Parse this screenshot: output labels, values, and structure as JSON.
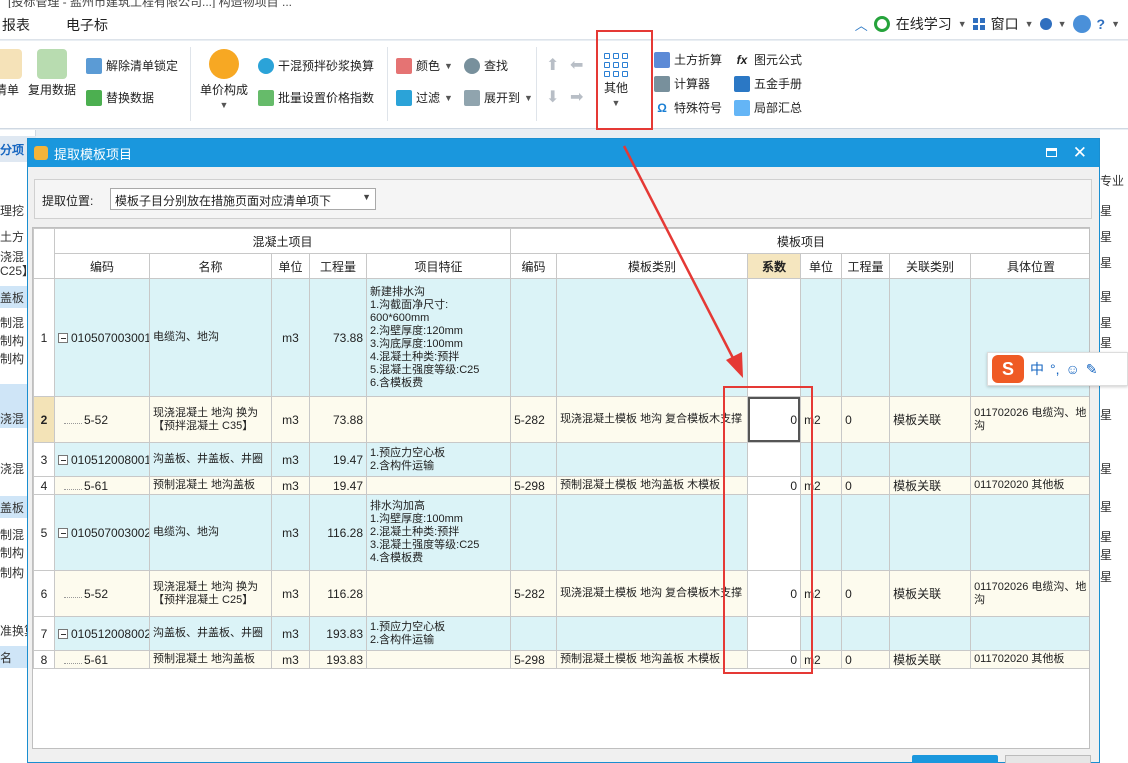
{
  "window": {
    "title_partial": "[投标管理 - 盐州市建筑工程有限公司...] 构造物项目 ...",
    "menu": [
      "报表",
      "电子标"
    ],
    "right": {
      "online": "在线学习",
      "window": "窗口",
      "help": "?"
    }
  },
  "ribbon": {
    "g1": {
      "qingdan": "清单",
      "reuse": "复用数据",
      "unlock": "解除清单锁定",
      "replace": "替换数据"
    },
    "g2": {
      "unit_compose": "单价构成",
      "mortar": "干混预拌砂浆换算",
      "batch_price": "批量设置价格指数"
    },
    "g3": {
      "color": "颜色",
      "find": "查找",
      "filter": "过滤",
      "expand": "展开到"
    },
    "g4": {
      "other": "其他"
    },
    "g5": {
      "earth": "土方折算",
      "calc": "计算器",
      "special": "特殊符号",
      "formula": "图元公式",
      "hardware": "五金手册",
      "local_sum": "局部汇总"
    }
  },
  "background": {
    "left_tab": "分项",
    "left_rows": [
      "理挖",
      "土方",
      "浇混",
      "C25】",
      "盖板",
      "制混",
      "制构",
      "制构",
      "浇混",
      "浇混",
      "盖板",
      "制混",
      "制构",
      "制构",
      "准换算",
      "名"
    ],
    "right_header": "专业",
    "right_rows": [
      "星",
      "星",
      "星",
      "星",
      "星",
      "星",
      "星",
      "星",
      "星",
      "星",
      "星",
      "星"
    ]
  },
  "dialog": {
    "title": "提取模板项目",
    "position_label": "提取位置:",
    "position_value": "模板子目分别放在措施页面对应清单项下",
    "group_concrete": "混凝土项目",
    "group_formwork": "模板项目",
    "columns": {
      "code": "编码",
      "name": "名称",
      "unit": "单位",
      "qty": "工程量",
      "feature": "项目特征",
      "f_code": "编码",
      "f_type": "模板类别",
      "coef": "系数",
      "f_unit": "单位",
      "f_qty": "工程量",
      "relation": "关联类别",
      "location": "具体位置"
    },
    "rows": [
      {
        "idx": "1",
        "code": "010507003001",
        "name": "电缆沟、地沟",
        "unit": "m3",
        "qty": "73.88",
        "feature": [
          "新建排水沟",
          "1.沟截面净尺寸:",
          "600*600mm",
          "2.沟壁厚度:120mm",
          "3.沟底厚度:100mm",
          "4.混凝土种类:预拌",
          "5.混凝土强度等级:C25",
          "6.含模板费"
        ],
        "f_code": "",
        "f_type": "",
        "coef": "",
        "f_unit": "",
        "f_qty": "",
        "relation": "",
        "location": ""
      },
      {
        "idx": "2",
        "code": "5-52",
        "name": "现浇混凝土 地沟  换为【预拌混凝土 C35】",
        "unit": "m3",
        "qty": "73.88",
        "feature": [],
        "f_code": "5-282",
        "f_type": "现浇混凝土模板 地沟 复合模板木支撑",
        "coef": "0",
        "f_unit": "m2",
        "f_qty": "0",
        "relation": "模板关联",
        "location": "011702026  电缆沟、地沟"
      },
      {
        "idx": "3",
        "code": "010512008001",
        "name": "沟盖板、井盖板、井圈",
        "unit": "m3",
        "qty": "19.47",
        "feature": [
          "1.预应力空心板",
          "2.含构件运输"
        ],
        "f_code": "",
        "f_type": "",
        "coef": "",
        "f_unit": "",
        "f_qty": "",
        "relation": "",
        "location": ""
      },
      {
        "idx": "4",
        "code": "5-61",
        "name": "预制混凝土 地沟盖板",
        "unit": "m3",
        "qty": "19.47",
        "feature": [],
        "f_code": "5-298",
        "f_type": "预制混凝土模板 地沟盖板 木模板",
        "coef": "0",
        "f_unit": "m2",
        "f_qty": "0",
        "relation": "模板关联",
        "location": "011702020  其他板"
      },
      {
        "idx": "5",
        "code": "010507003002",
        "name": "电缆沟、地沟",
        "unit": "m3",
        "qty": "116.28",
        "feature": [
          "排水沟加高",
          "1.沟壁厚度:100mm",
          "2.混凝土种类:预拌",
          "3.混凝土强度等级:C25",
          "4.含模板费"
        ],
        "f_code": "",
        "f_type": "",
        "coef": "",
        "f_unit": "",
        "f_qty": "",
        "relation": "",
        "location": ""
      },
      {
        "idx": "6",
        "code": "5-52",
        "name": "现浇混凝土 地沟  换为【预拌混凝土 C25】",
        "unit": "m3",
        "qty": "116.28",
        "feature": [],
        "f_code": "5-282",
        "f_type": "现浇混凝土模板 地沟 复合模板木支撑",
        "coef": "0",
        "f_unit": "m2",
        "f_qty": "0",
        "relation": "模板关联",
        "location": "011702026  电缆沟、地沟"
      },
      {
        "idx": "7",
        "code": "010512008002",
        "name": "沟盖板、井盖板、井圈",
        "unit": "m3",
        "qty": "193.83",
        "feature": [
          "1.预应力空心板",
          "2.含构件运输"
        ],
        "f_code": "",
        "f_type": "",
        "coef": "",
        "f_unit": "",
        "f_qty": "",
        "relation": "",
        "location": ""
      },
      {
        "idx": "8",
        "code": "5-61",
        "name": "预制混凝土 地沟盖板",
        "unit": "m3",
        "qty": "193.83",
        "feature": [],
        "f_code": "5-298",
        "f_type": "预制混凝土模板 地沟盖板 木模板",
        "coef": "0",
        "f_unit": "m2",
        "f_qty": "0",
        "relation": "模板关联",
        "location": "011702020  其他板"
      }
    ]
  },
  "ime": {
    "logo": "S",
    "lang": "中",
    "punct": "°,"
  },
  "colors": {
    "accent": "#1a97dd",
    "highlight": "#e53935",
    "row_blue": "#dbf3f7",
    "row_yellow": "#fdfbee"
  }
}
